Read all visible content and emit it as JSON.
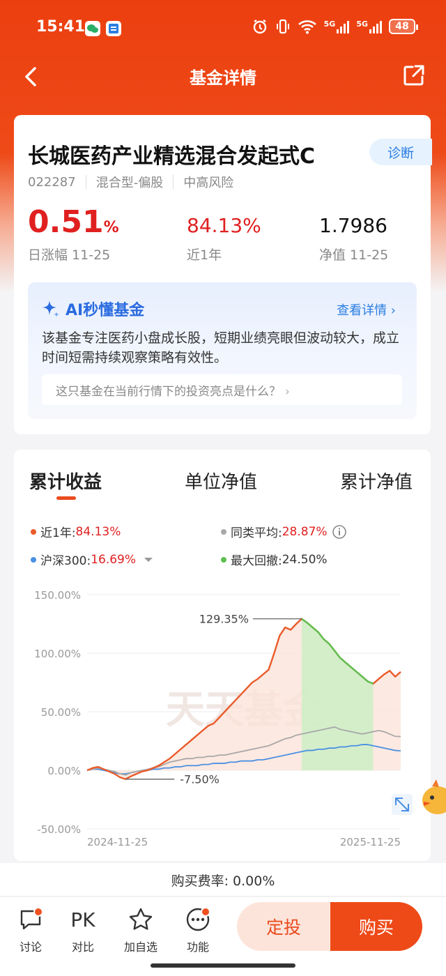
{
  "status_bar": {
    "time": "15:41",
    "battery": "48",
    "net1": "5G",
    "net2": "5G"
  },
  "nav": {
    "title": "基金详情"
  },
  "fund": {
    "name": "长城医药产业精选混合发起式C",
    "diagnose_label": "诊断",
    "code": "022287",
    "type": "混合型-偏股",
    "risk": "中高风险",
    "daily_change": "0.51",
    "daily_change_unit": "%",
    "daily_change_label": "日涨幅 11-25",
    "one_year": "84.13%",
    "one_year_label": "近1年",
    "nav_value": "1.7986",
    "nav_label": "净值 11-25"
  },
  "ai": {
    "title": "AI秒懂基金",
    "more": "查看详情",
    "summary": "该基金专注医药小盘成长股，短期业绩亮眼但波动较大，成立时间短需持续观察策略有效性。",
    "question": "这只基金在当前行情下的投资亮点是什么？"
  },
  "chart_tabs": [
    "累计收益",
    "单位净值",
    "累计净值"
  ],
  "legend": {
    "fund_label": "近1年:",
    "fund_value": "84.13%",
    "peer_label": "同类平均:",
    "peer_value": "28.87%",
    "index_label": "沪深300:",
    "index_value": "16.69%",
    "drawdown_label": "最大回撤:",
    "drawdown_value": "24.50%"
  },
  "colors": {
    "fund": "#ea5a2a",
    "peer": "#a8a8a8",
    "index": "#4a90e2",
    "drawdown": "#5cc04e",
    "accent": "#ee4a18"
  },
  "chart_data": {
    "type": "line",
    "x_start": "2024-11-25",
    "x_end": "2025-11-25",
    "y_ticks": [
      "150.00%",
      "100.00%",
      "50.00%",
      "0.00%",
      "-50.00%"
    ],
    "ylim": [
      -50,
      150
    ],
    "annotations": {
      "peak": "129.35%",
      "trough": "-7.50%"
    },
    "watermark": "天天基金",
    "series": [
      {
        "name": "近1年",
        "values": [
          0,
          2,
          3,
          1,
          -1,
          -3,
          -6,
          -7.5,
          -5,
          -3,
          -1,
          0,
          2,
          4,
          7,
          10,
          14,
          18,
          22,
          26,
          30,
          34,
          38,
          40,
          45,
          50,
          55,
          60,
          65,
          70,
          75,
          78,
          82,
          86,
          100,
          115,
          122,
          120,
          125,
          129.35,
          126,
          122,
          118,
          112,
          108,
          102,
          96,
          92,
          88,
          84,
          80,
          76,
          74,
          78,
          82,
          85,
          80,
          84.13
        ]
      },
      {
        "name": "同类平均",
        "values": [
          0,
          1,
          2,
          1,
          0,
          -1,
          -3,
          -4,
          -2,
          -1,
          0,
          1,
          2,
          3,
          5,
          7,
          8,
          9,
          10,
          10,
          11,
          11,
          12,
          12,
          13,
          13,
          14,
          15,
          16,
          17,
          18,
          19,
          20,
          21,
          23,
          25,
          27,
          28,
          30,
          31,
          32,
          33,
          34,
          35,
          36,
          37,
          35,
          34,
          33,
          32,
          31,
          32,
          33,
          34,
          33,
          31,
          29,
          28.87
        ]
      },
      {
        "name": "沪深300",
        "values": [
          0,
          1,
          1,
          0,
          -1,
          -2,
          -3,
          -3,
          -2,
          -1,
          0,
          0,
          1,
          1,
          2,
          2,
          3,
          3,
          4,
          4,
          4,
          5,
          5,
          6,
          6,
          6,
          7,
          7,
          8,
          8,
          8,
          9,
          9,
          10,
          11,
          12,
          13,
          14,
          15,
          16,
          17,
          17,
          18,
          18,
          19,
          19,
          20,
          20,
          21,
          21,
          22,
          22,
          21,
          20,
          19,
          18,
          17,
          16.69
        ]
      }
    ],
    "max_drawdown": {
      "peak_index": 39,
      "trough_index": 52
    }
  },
  "fee": "购买费率: 0.00%",
  "bottom_nav": [
    {
      "label": "讨论",
      "icon": "chat-icon"
    },
    {
      "label": "对比",
      "icon": "PK"
    },
    {
      "label": "加自选",
      "icon": "star-icon"
    },
    {
      "label": "功能",
      "icon": "more-icon"
    }
  ],
  "actions": {
    "dingtou": "定投",
    "buy": "购买"
  }
}
